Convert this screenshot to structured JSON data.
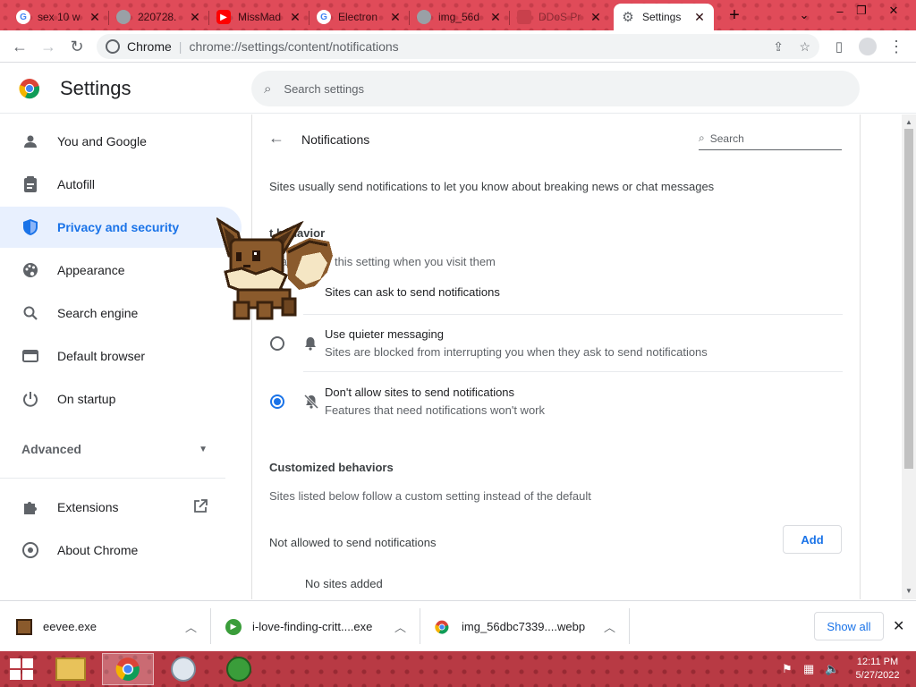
{
  "tabs": [
    {
      "title": "sex 10 w",
      "icon": "google-icon"
    },
    {
      "title": "220728.",
      "icon": "globe-icon"
    },
    {
      "title": "MissMad",
      "icon": "youtube-icon"
    },
    {
      "title": "Electron",
      "icon": "google-icon"
    },
    {
      "title": "img_56d",
      "icon": "globe-icon"
    },
    {
      "title": "DDoS Pr",
      "icon": "page-icon"
    },
    {
      "title": "Settings",
      "icon": "gear-icon",
      "active": true
    }
  ],
  "toolbar": {
    "site_label": "Chrome",
    "url": "chrome://settings/content/notifications"
  },
  "header": {
    "title": "Settings",
    "search_placeholder": "Search settings"
  },
  "sidebar": {
    "items": [
      {
        "label": "You and Google",
        "icon": "person-icon"
      },
      {
        "label": "Autofill",
        "icon": "clipboard-icon"
      },
      {
        "label": "Privacy and security",
        "icon": "shield-icon",
        "active": true
      },
      {
        "label": "Appearance",
        "icon": "palette-icon"
      },
      {
        "label": "Search engine",
        "icon": "search-icon"
      },
      {
        "label": "Default browser",
        "icon": "browser-icon"
      },
      {
        "label": "On startup",
        "icon": "power-icon"
      }
    ],
    "advanced": "Advanced",
    "extensions": "Extensions",
    "about": "About Chrome"
  },
  "page": {
    "title": "Notifications",
    "search_placeholder": "Search",
    "description": "Sites usually send notifications to let you know about breaking news or chat messages",
    "default_behavior_heading": "t behavior",
    "default_behavior_sub": "tically follow this setting when you visit them",
    "options": [
      {
        "label": "Sites can ask to send notifications",
        "sub": "",
        "checked": false
      },
      {
        "label": "Use quieter messaging",
        "sub": "Sites are blocked from interrupting you when they ask to send notifications",
        "checked": false
      },
      {
        "label": "Don't allow sites to send notifications",
        "sub": "Features that need notifications won't work",
        "checked": true
      }
    ],
    "customized_heading": "Customized behaviors",
    "customized_sub": "Sites listed below follow a custom setting instead of the default",
    "not_allowed_label": "Not allowed to send notifications",
    "add_button": "Add",
    "no_sites": "No sites added"
  },
  "downloads": {
    "items": [
      {
        "name": "eevee.exe",
        "icon": "eevee-icon"
      },
      {
        "name": "i-love-finding-critt....exe",
        "icon": "green-play-icon"
      },
      {
        "name": "img_56dbc7339....webp",
        "icon": "chrome-icon"
      }
    ],
    "show_all": "Show all"
  },
  "taskbar": {
    "time": "12:11 PM",
    "date": "5/27/2022"
  },
  "colors": {
    "accent": "#1a73e8",
    "tabstrip": "#e04b59",
    "taskbar": "#b83a44"
  }
}
